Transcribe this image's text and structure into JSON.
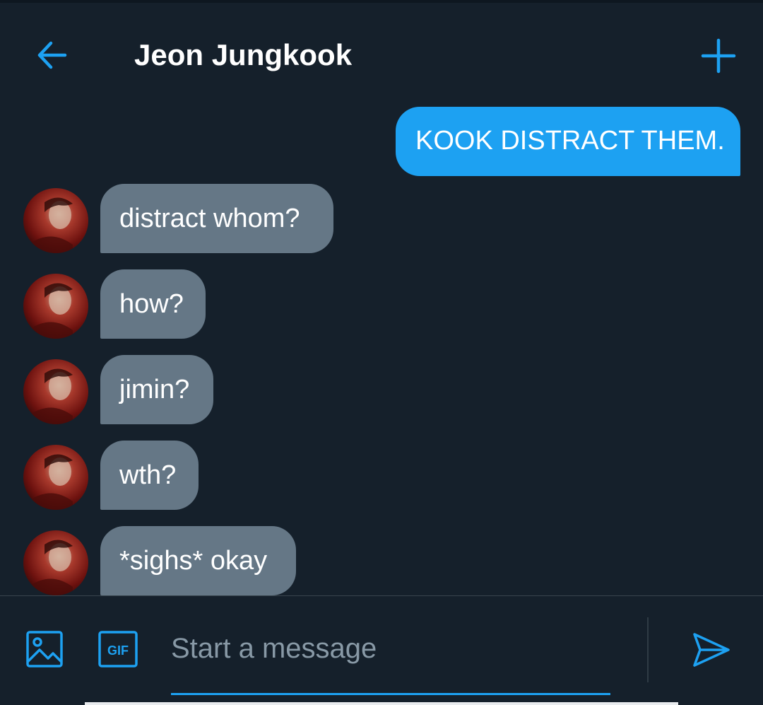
{
  "header": {
    "title": "Jeon Jungkook",
    "back_icon": "arrow-left-icon",
    "plus_icon": "plus-icon"
  },
  "messages": [
    {
      "direction": "outgoing",
      "text": "KOOK DISTRACT THEM."
    },
    {
      "direction": "incoming",
      "text": "distract whom?"
    },
    {
      "direction": "incoming",
      "text": "how?"
    },
    {
      "direction": "incoming",
      "text": "jimin?"
    },
    {
      "direction": "incoming",
      "text": "wth?"
    },
    {
      "direction": "incoming",
      "text": "*sighs* okay"
    }
  ],
  "composer": {
    "placeholder": "Start a message",
    "gif_label": "GIF",
    "image_icon": "image-icon",
    "gif_icon": "gif-icon",
    "send_icon": "send-icon"
  },
  "colors": {
    "background": "#15202b",
    "accent": "#1da1f2",
    "incoming_bubble": "#657786",
    "placeholder": "#8899a6",
    "divider": "#38444d"
  }
}
